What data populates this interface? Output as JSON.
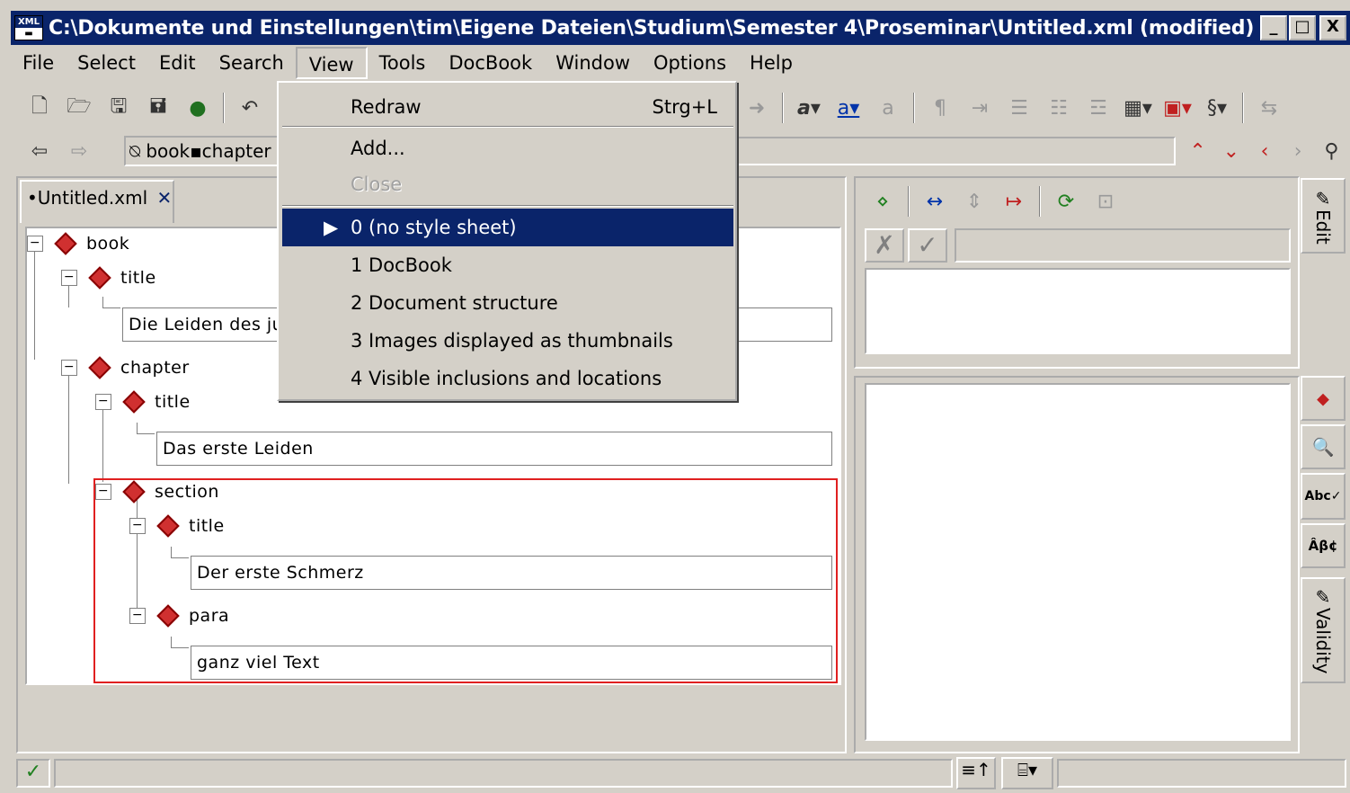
{
  "window": {
    "title": "C:\\Dokumente und Einstellungen\\tim\\Eigene Dateien\\Studium\\Semester 4\\Proseminar\\Untitled.xml (modified)",
    "app_icon": "XML",
    "min": "_",
    "max": "□",
    "close": "X"
  },
  "menu": [
    "File",
    "Select",
    "Edit",
    "Search",
    "View",
    "Tools",
    "DocBook",
    "Window",
    "Options",
    "Help"
  ],
  "breadcrumb": "book▪chapter",
  "doc_tab": {
    "label": "•Untitled.xml",
    "close": "✕"
  },
  "tree": {
    "book": "book",
    "title1": "title",
    "title1_text": "Die Leiden des ju",
    "chapter": "chapter",
    "title2": "title",
    "title2_text": "Das erste Leiden",
    "section": "section",
    "title3": "title",
    "title3_text": "Der erste Schmerz",
    "para": "para",
    "para_text": "ganz viel Text"
  },
  "view_menu": {
    "redraw": "Redraw",
    "redraw_shortcut": "Strg+L",
    "add": "Add...",
    "close": "Close",
    "sheets": [
      "0 (no style sheet)",
      "1 DocBook",
      "2 Document structure",
      "3 Images displayed as thumbnails",
      "4 Visible inclusions and locations"
    ]
  },
  "side_tabs": {
    "edit": "Edit",
    "validity": "Validity"
  },
  "colors": {
    "title_bar": "#0a246a",
    "selection": "#0a246a",
    "element_red": "#d03030",
    "highlight_border": "#e02020"
  }
}
